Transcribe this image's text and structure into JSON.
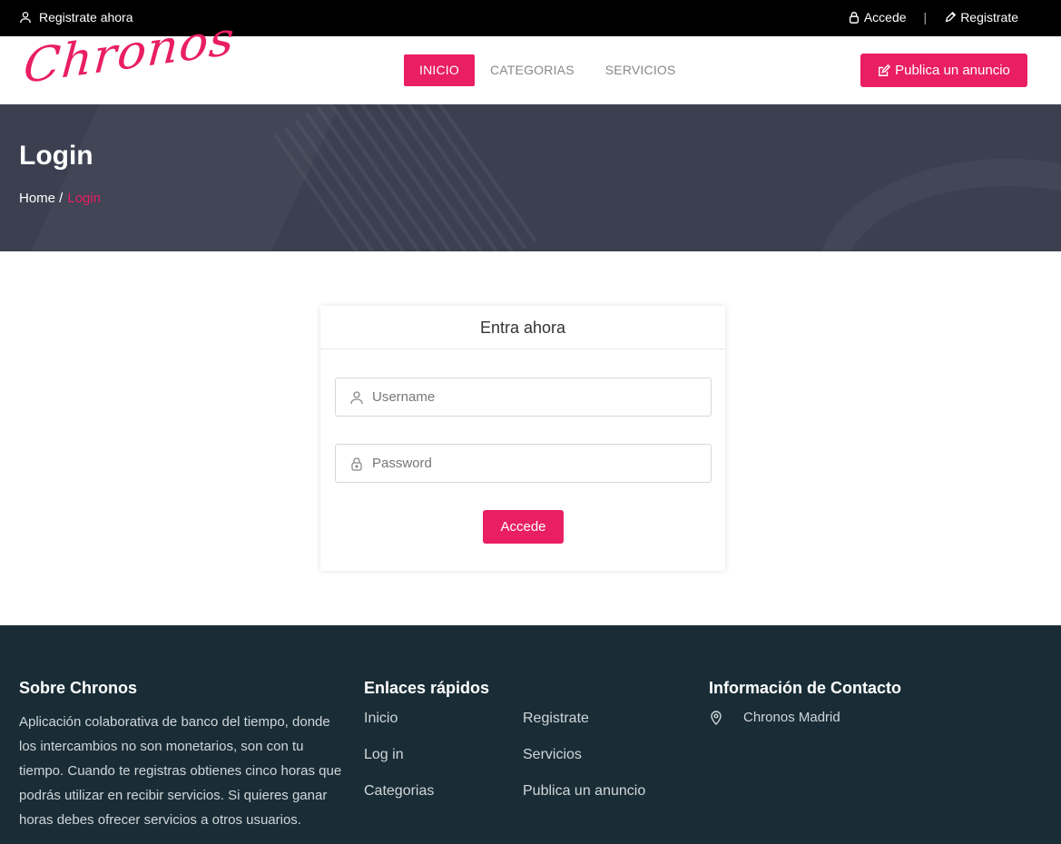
{
  "topbar": {
    "register_now": "Registrate ahora",
    "login": "Accede",
    "separator": "|",
    "register": "Registrate"
  },
  "header": {
    "logo_text": "Chronos",
    "nav": [
      {
        "label": "INICIO",
        "active": true
      },
      {
        "label": "CATEGORIAS",
        "active": false
      },
      {
        "label": "SERVICIOS",
        "active": false
      }
    ],
    "publish_button": "Publica un anuncio"
  },
  "hero": {
    "title": "Login",
    "breadcrumb": {
      "home": "Home /",
      "current": "Login"
    }
  },
  "login_card": {
    "title": "Entra ahora",
    "username_placeholder": "Username",
    "password_placeholder": "Password",
    "submit_label": "Accede"
  },
  "footer": {
    "about": {
      "title": "Sobre Chronos",
      "text": "Aplicación colaborativa de banco del tiempo, donde los intercambios no son monetarios, son con tu tiempo. Cuando te registras obtienes cinco horas que podrás utilizar en recibir servicios. Si quieres ganar horas debes ofrecer servicios a otros usuarios."
    },
    "quick_links": {
      "title": "Enlaces rápidos",
      "col1": [
        "Inicio",
        "Log in",
        "Categorias"
      ],
      "col2": [
        "Registrate",
        "Servicios",
        "Publica un anuncio"
      ]
    },
    "contact": {
      "title": "Información de Contacto",
      "location": "Chronos Madrid"
    }
  },
  "colors": {
    "accent": "#e91e63",
    "topbar_bg": "#000000",
    "hero_bg": "#3b3f50",
    "footer_bg": "#1a2d36"
  }
}
